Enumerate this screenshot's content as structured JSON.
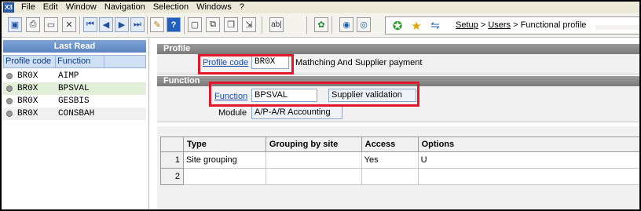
{
  "app": {
    "icon_label": "X3"
  },
  "menu": {
    "items": [
      {
        "label": "File"
      },
      {
        "label": "Edit"
      },
      {
        "label": "Window"
      },
      {
        "label": "Navigation"
      },
      {
        "label": "Selection"
      },
      {
        "label": "Windows"
      },
      {
        "label": "?"
      }
    ]
  },
  "toolbar": {
    "icons": [
      "save-icon",
      "print-icon",
      "new-icon",
      "copy-icon",
      "delete-icon",
      "first-record-icon",
      "previous-record-icon",
      "next-record-icon",
      "last-record-icon",
      "edit-icon",
      "help-icon",
      "window-icon",
      "window-duplicate-icon",
      "window-cascade-icon",
      "export-icon",
      "text-field-icon",
      "refresh-icon",
      "search-icon",
      "favorites-icon",
      "star-icon",
      "navigation-icon"
    ],
    "text_field_label": "ab|",
    "help_label": "?"
  },
  "breadcrumb": {
    "setup": "Setup",
    "sep1": ">",
    "users": "Users",
    "sep2": ">",
    "current": "Functional profile"
  },
  "left_panel": {
    "title": "Last Read",
    "headers": {
      "profile_code": "Profile code",
      "function": "Function"
    },
    "rows": [
      {
        "code": "BR0X",
        "function": "AIMP"
      },
      {
        "code": "BR0X",
        "function": "BPSVAL"
      },
      {
        "code": "BR0X",
        "function": "GESBIS"
      },
      {
        "code": "BR0X",
        "function": "CONSBAH"
      }
    ]
  },
  "profile_section": {
    "title": "Profile",
    "profile_code_label": "Profile code",
    "profile_code_value": "BR0X",
    "profile_description": "Mathching And Supplier payment"
  },
  "function_section": {
    "title": "Function",
    "function_label": "Function",
    "function_value": "BPSVAL",
    "function_description": "Supplier validation",
    "module_label": "Module",
    "module_value": "A/P-A/R Accounting"
  },
  "grid": {
    "columns": [
      "Type",
      "Grouping by site",
      "Access",
      "Options"
    ],
    "rows": [
      {
        "num": "1",
        "type": "Site grouping",
        "grouping": "",
        "access": "Yes",
        "options": "U"
      },
      {
        "num": "2",
        "type": "",
        "grouping": "",
        "access": "",
        "options": ""
      }
    ]
  },
  "colors": {
    "highlight": "#e3162a",
    "section_header": "#8a8a8a",
    "left_panel_title": "#6b93c9",
    "link": "#1a4fb0"
  }
}
